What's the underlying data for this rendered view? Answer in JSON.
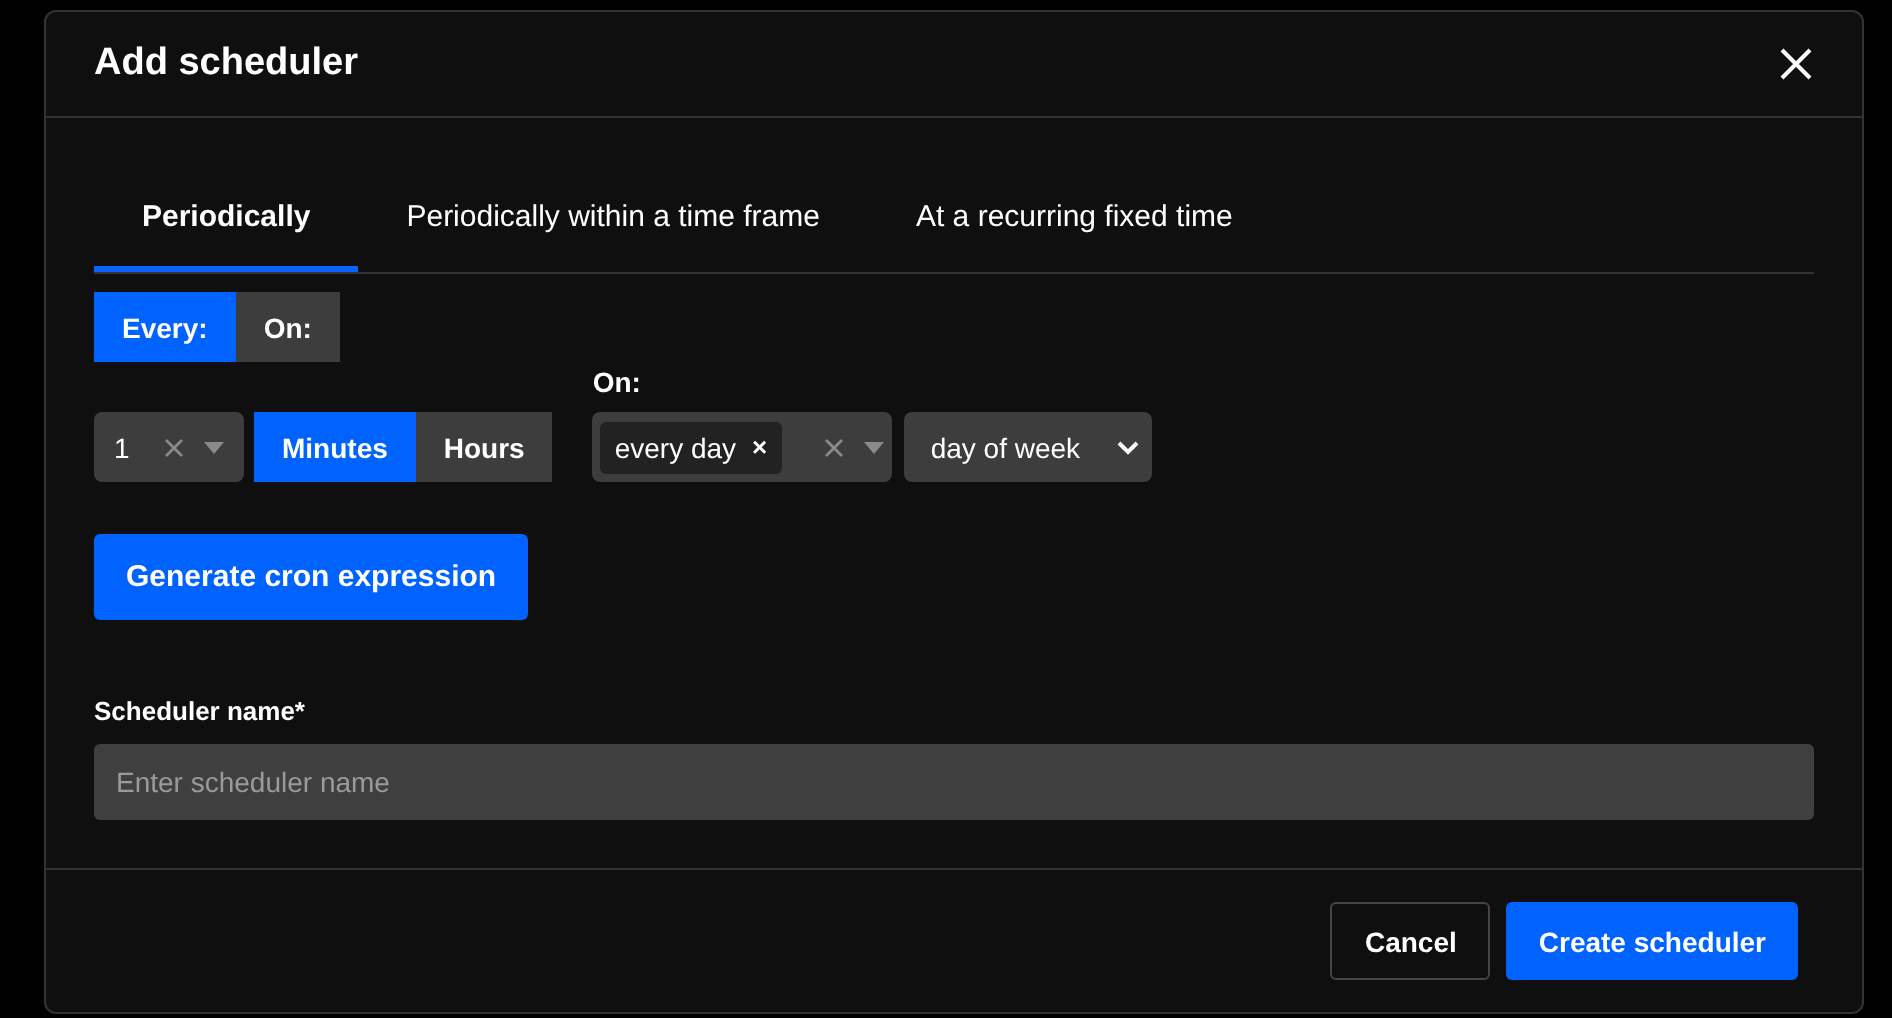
{
  "dialog": {
    "title": "Add scheduler"
  },
  "tabs": [
    {
      "label": "Periodically",
      "selected": true
    },
    {
      "label": "Periodically within a time frame",
      "selected": false
    },
    {
      "label": "At a recurring fixed time",
      "selected": false
    }
  ],
  "mode_toggle": [
    {
      "label": "Every:",
      "selected": true
    },
    {
      "label": "On:",
      "selected": false
    }
  ],
  "interval": {
    "value": "1",
    "units": [
      {
        "label": "Minutes",
        "selected": true
      },
      {
        "label": "Hours",
        "selected": false
      }
    ]
  },
  "on": {
    "label": "On:",
    "tags": [
      {
        "label": "every day",
        "remove": "×"
      }
    ],
    "select": "day of week"
  },
  "generate_button": "Generate cron expression",
  "name_field": {
    "label": "Scheduler name*",
    "placeholder": "Enter scheduler name"
  },
  "buttons": [
    {
      "label": "Cancel",
      "kind": "secondary"
    },
    {
      "label": "Create scheduler",
      "kind": "primary"
    }
  ]
}
